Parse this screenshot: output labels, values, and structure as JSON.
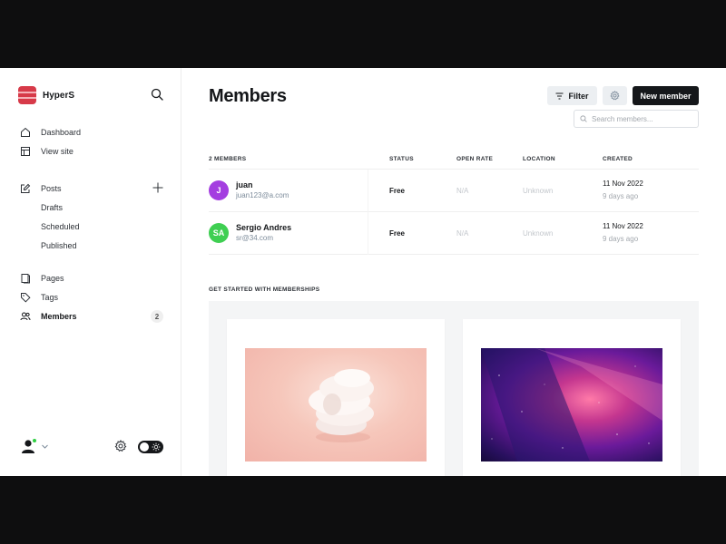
{
  "sidebar": {
    "brand": "HyperS",
    "items": [
      {
        "label": "Dashboard"
      },
      {
        "label": "View site"
      },
      {
        "label": "Posts"
      },
      {
        "label": "Drafts"
      },
      {
        "label": "Scheduled"
      },
      {
        "label": "Published"
      },
      {
        "label": "Pages"
      },
      {
        "label": "Tags"
      },
      {
        "label": "Members",
        "count": "2"
      }
    ]
  },
  "header": {
    "title": "Members",
    "filter_label": "Filter",
    "new_member_label": "New member",
    "search_placeholder": "Search members..."
  },
  "table": {
    "columns": [
      "2 MEMBERS",
      "STATUS",
      "OPEN RATE",
      "LOCATION",
      "CREATED"
    ],
    "rows": [
      {
        "initials": "J",
        "avatar_color": "#a43ee0",
        "name": "juan",
        "email": "juan123@a.com",
        "status": "Free",
        "open_rate": "N/A",
        "location": "Unknown",
        "created": "11 Nov 2022",
        "created_ago": "9 days ago"
      },
      {
        "initials": "SA",
        "avatar_color": "#3fcf52",
        "name": "Sergio Andres",
        "email": "sr@34.com",
        "status": "Free",
        "open_rate": "N/A",
        "location": "Unknown",
        "created": "11 Nov 2022",
        "created_ago": "9 days ago"
      }
    ]
  },
  "memberships": {
    "title": "GET STARTED WITH MEMBERSHIPS"
  },
  "colors": {
    "accent": "#15171a",
    "brand": "#d73a49",
    "online": "#30cf43"
  }
}
